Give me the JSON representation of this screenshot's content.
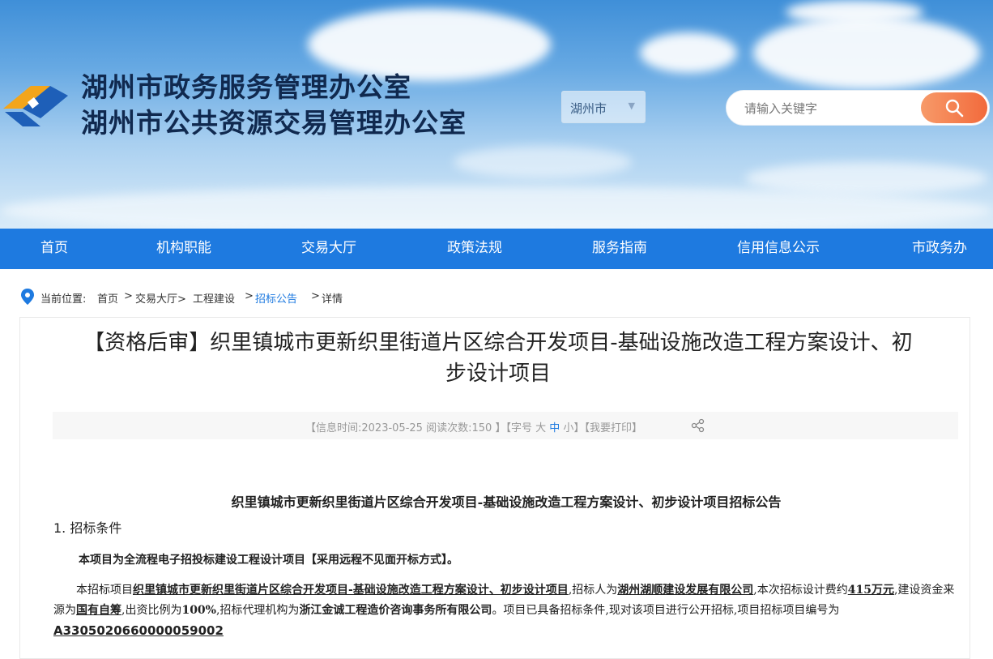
{
  "header": {
    "title_line1": "湖州市政务服务管理办公室",
    "title_line2": "湖州市公共资源交易管理办公室",
    "logo_icon": "emblem-logo-icon",
    "city_select": "湖州市",
    "search_placeholder": "请输入关键字"
  },
  "nav": {
    "items": [
      "首页",
      "机构职能",
      "交易大厅",
      "政策法规",
      "服务指南",
      "信用信息公示",
      "市政务办"
    ]
  },
  "breadcrumb": {
    "label": "当前位置:",
    "items": [
      "首页",
      ">",
      "交易大厅>",
      "工程建设",
      ">",
      "招标公告",
      ">",
      "详情"
    ]
  },
  "article": {
    "title_line1": "【资格后审】织里镇城市更新织里街道片区综合开发项目-基础设施改造工程方案设计、初",
    "title_line2": "步设计项目",
    "info_prefix": "【信息时间:",
    "date": "2023-05-25",
    "views_label": "阅读次数:",
    "views": "150",
    "size_prefix": "】【字号",
    "size_large": "大",
    "size_medium": "中",
    "size_small": "小",
    "print_label": "】【我要打印】",
    "doc_title": "织里镇城市更新织里街道片区综合开发项目-基础设施改造工程方案设计、初步设计项目招标公告",
    "section1": "1. 招标条件",
    "para1": "本项目为全流程电子招投标建设工程设计项目【采用远程不见面开标方式】。",
    "para2": {
      "t1": "本招标项目",
      "project": "织里镇城市更新织里街道片区综合开发项目-基础设施改造工程方案设计、初步设计项目",
      "t2": ",招标人为",
      "tenderer": "湖州湖顺建设发展有限公司",
      "t3": ",本次招标设计费约",
      "fee": "415万元",
      "t4": ",建设资金来源为",
      "fund": "国有自筹",
      "t5": ",出资比例为",
      "ratio": "100%",
      "t6": ",招标代理机构为",
      "agent": "浙江金诚工程造价咨询事务所有限公司",
      "t7": "。项目已具备招标条件,现对该项目进行公开招标,项目招标项目编号为",
      "code": "A3305020660000059002"
    }
  }
}
